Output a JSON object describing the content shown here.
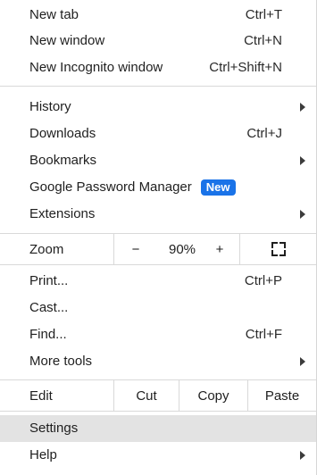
{
  "menu": {
    "new_tab": {
      "label": "New tab",
      "shortcut": "Ctrl+T"
    },
    "new_window": {
      "label": "New window",
      "shortcut": "Ctrl+N"
    },
    "new_incognito": {
      "label": "New Incognito window",
      "shortcut": "Ctrl+Shift+N"
    },
    "history": {
      "label": "History"
    },
    "downloads": {
      "label": "Downloads",
      "shortcut": "Ctrl+J"
    },
    "bookmarks": {
      "label": "Bookmarks"
    },
    "password_manager": {
      "label": "Google Password Manager",
      "badge": "New"
    },
    "extensions": {
      "label": "Extensions"
    },
    "zoom": {
      "label": "Zoom",
      "minus": "−",
      "value": "90%",
      "plus": "+",
      "fullscreen_icon": "fullscreen-icon"
    },
    "print": {
      "label": "Print...",
      "shortcut": "Ctrl+P"
    },
    "cast": {
      "label": "Cast..."
    },
    "find": {
      "label": "Find...",
      "shortcut": "Ctrl+F"
    },
    "more_tools": {
      "label": "More tools"
    },
    "edit": {
      "label": "Edit",
      "cut": "Cut",
      "copy": "Copy",
      "paste": "Paste"
    },
    "settings": {
      "label": "Settings"
    },
    "help": {
      "label": "Help"
    }
  },
  "colors": {
    "badge_bg": "#1a73e8",
    "highlight_bg": "#e3e3e3",
    "separator": "#d9d9d9"
  }
}
